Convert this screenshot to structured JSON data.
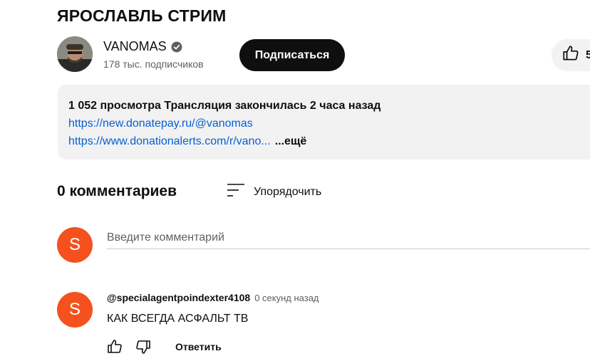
{
  "video": {
    "title": "ЯРОСЛАВЛЬ СТРИМ"
  },
  "channel": {
    "name": "VANOMAS",
    "subscribers": "178 тыс. подписчиков",
    "subscribe_label": "Подписаться",
    "like_count": "5"
  },
  "description": {
    "meta": "1 052 просмотра  Трансляция закончилась 2 часа назад",
    "link1": "https://new.donatepay.ru/@vanomas",
    "link2": "https://www.donationalerts.com/r/vano...",
    "more": "...ещё"
  },
  "comments": {
    "count_label": "0 комментариев",
    "sort_label": "Упорядочить",
    "input_placeholder": "Введите комментарий",
    "user_avatar_letter": "S",
    "items": [
      {
        "avatar_letter": "S",
        "author": "@specialagentpoindexter4108",
        "time": "0 секунд назад",
        "text": "КАК ВСЕГДА АСФАЛЬТ ТВ",
        "reply_label": "Ответить"
      }
    ]
  },
  "colors": {
    "avatar_bg": "#f4511e",
    "link": "#065fd4",
    "subscribe_bg": "#0f0f0f"
  },
  "icons": [
    "verified-icon",
    "thumbs-up-icon",
    "sort-icon",
    "thumbs-down-icon"
  ]
}
